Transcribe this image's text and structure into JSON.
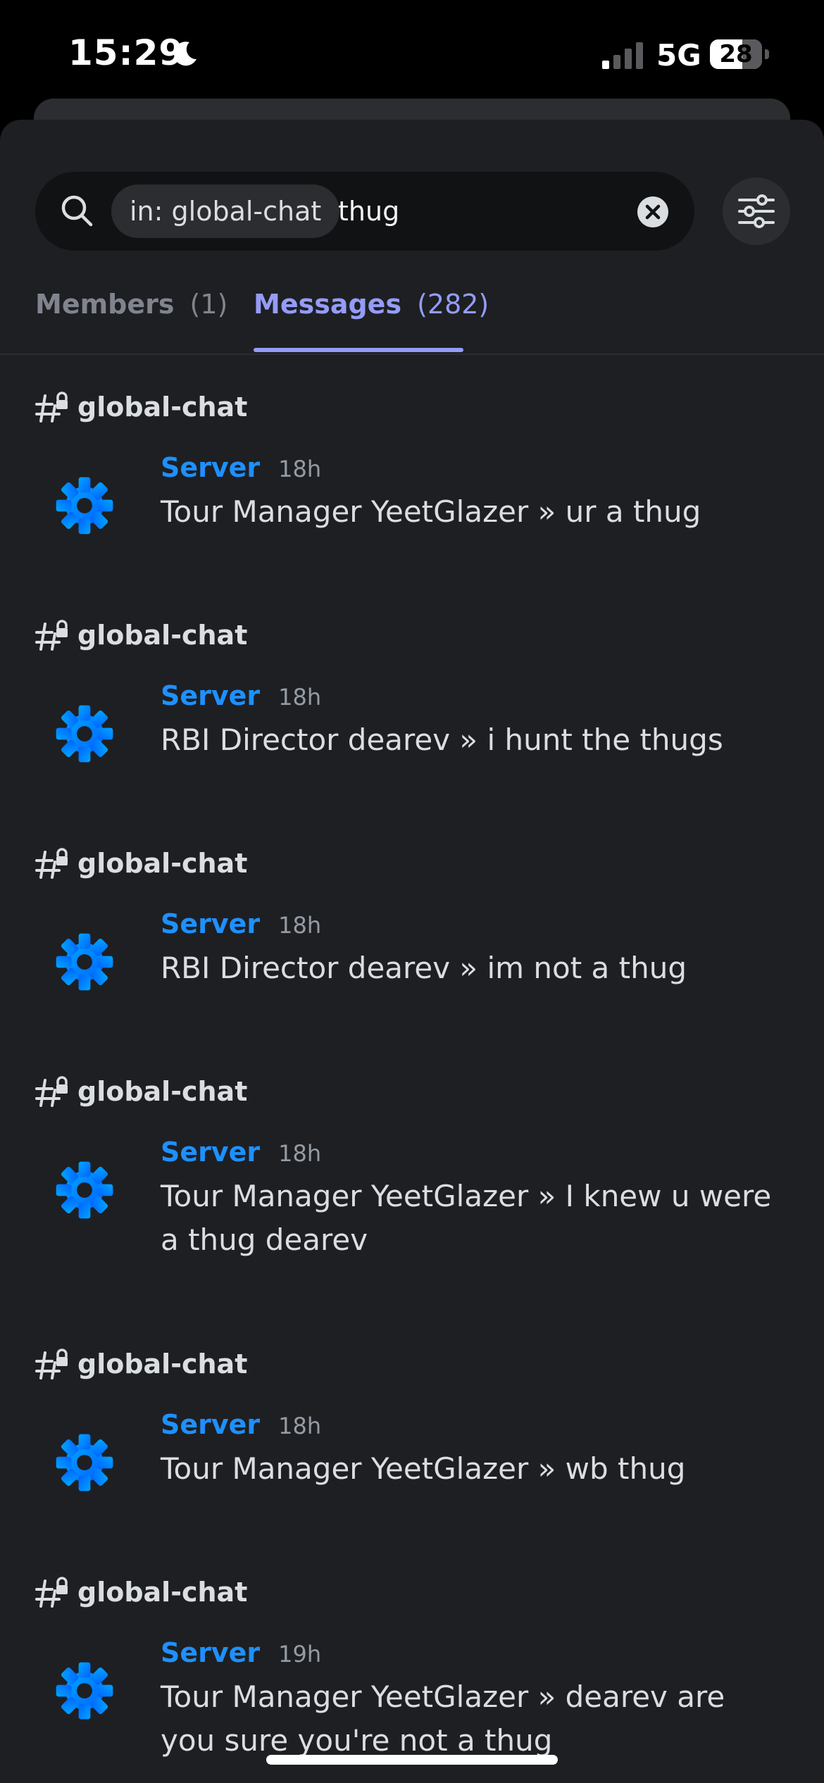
{
  "status_bar": {
    "time": "15:29",
    "network": "5G",
    "battery": "28"
  },
  "search": {
    "filter_chip": "in: global-chat",
    "query": "thug"
  },
  "tabs": [
    {
      "label": "Members",
      "count": "(1)",
      "active": false
    },
    {
      "label": "Messages",
      "count": "(282)",
      "active": true
    }
  ],
  "results": [
    {
      "channel": "global-chat",
      "author": "Server",
      "time": "18h",
      "text": "Tour Manager YeetGlazer » ur a thug"
    },
    {
      "channel": "global-chat",
      "author": "Server",
      "time": "18h",
      "text": "RBI Director dearev » i hunt the thugs"
    },
    {
      "channel": "global-chat",
      "author": "Server",
      "time": "18h",
      "text": "RBI Director dearev » im not a thug"
    },
    {
      "channel": "global-chat",
      "author": "Server",
      "time": "18h",
      "text": "Tour Manager YeetGlazer » I knew u were a thug dearev"
    },
    {
      "channel": "global-chat",
      "author": "Server",
      "time": "18h",
      "text": "Tour Manager YeetGlazer » wb thug"
    },
    {
      "channel": "global-chat",
      "author": "Server",
      "time": "19h",
      "text": "Tour Manager YeetGlazer » dearev are you sure you're not a thug"
    }
  ],
  "colors": {
    "background": "#1e1f22",
    "accent": "#949cf7",
    "author": "#1e90ff"
  },
  "icons": {
    "search": "search-icon",
    "clear": "clear-icon",
    "filter": "filter-icon",
    "channel": "locked-channel-icon",
    "avatar": "gear-icon"
  }
}
